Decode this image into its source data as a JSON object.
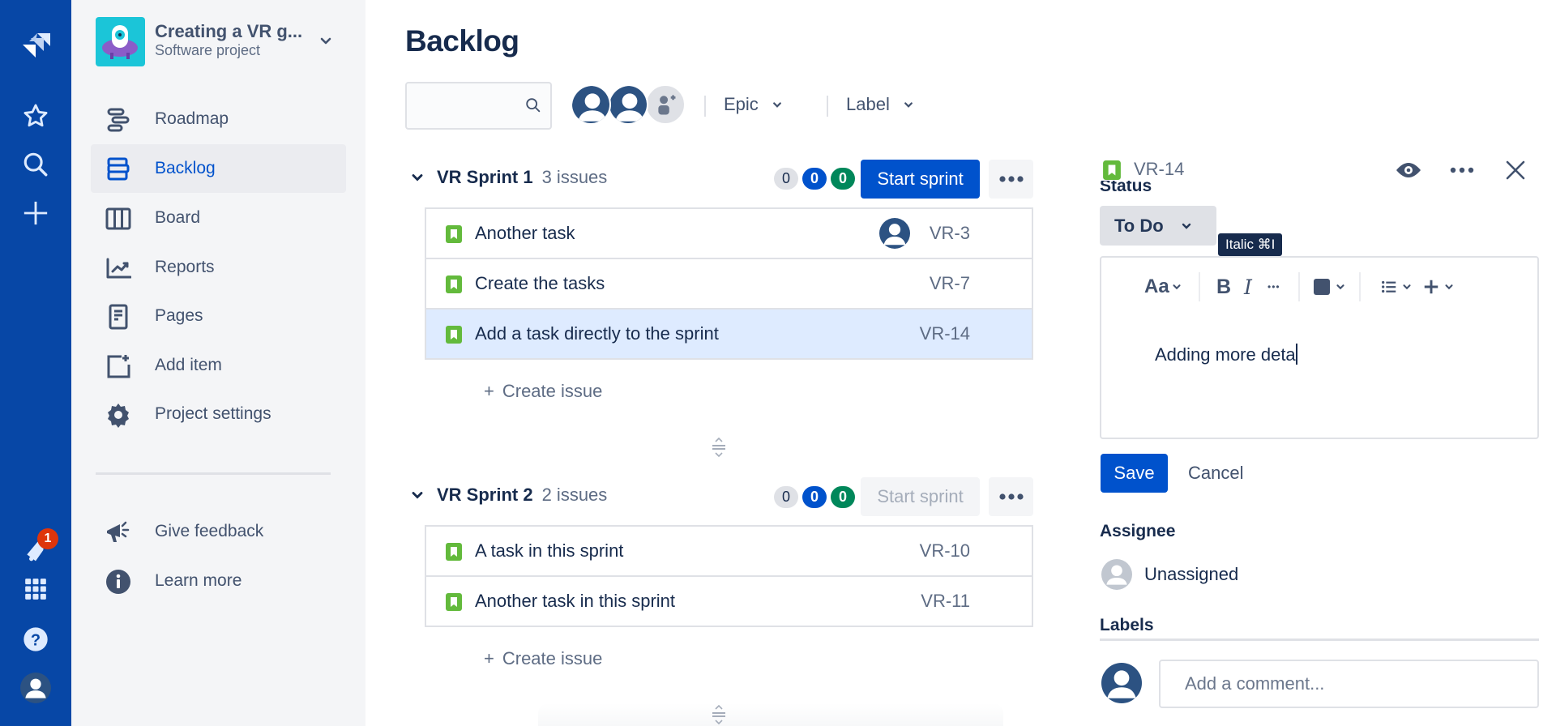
{
  "global_nav": {
    "notification_count": "1",
    "icons": [
      "jira-logo-icon",
      "star-icon",
      "search-icon",
      "plus-icon",
      "bell-icon",
      "app-switcher-icon",
      "help-icon",
      "profile-avatar-icon"
    ]
  },
  "project": {
    "name": "Creating a VR g...",
    "type": "Software project"
  },
  "sidebar": {
    "items": [
      {
        "label": "Roadmap",
        "icon": "roadmap-icon"
      },
      {
        "label": "Backlog",
        "icon": "backlog-icon",
        "active": true
      },
      {
        "label": "Board",
        "icon": "board-icon"
      },
      {
        "label": "Reports",
        "icon": "reports-icon"
      },
      {
        "label": "Pages",
        "icon": "pages-icon"
      },
      {
        "label": "Add item",
        "icon": "add-item-icon"
      },
      {
        "label": "Project settings",
        "icon": "gear-icon"
      }
    ],
    "footer": [
      {
        "label": "Give feedback",
        "icon": "megaphone-icon"
      },
      {
        "label": "Learn more",
        "icon": "info-icon"
      }
    ]
  },
  "page": {
    "title": "Backlog",
    "search_placeholder": "",
    "filters": {
      "epic": "Epic",
      "label": "Label"
    }
  },
  "sprints": [
    {
      "name": "VR Sprint 1",
      "count": "3 issues",
      "lozenges": [
        "0",
        "0",
        "0"
      ],
      "start_label": "Start sprint",
      "start_enabled": true,
      "issues": [
        {
          "summary": "Another task",
          "key": "VR-3",
          "has_assignee": true
        },
        {
          "summary": "Create the tasks",
          "key": "VR-7"
        },
        {
          "summary": "Add a task directly to the sprint",
          "key": "VR-14",
          "selected": true
        }
      ],
      "create_label": "Create issue"
    },
    {
      "name": "VR Sprint 2",
      "count": "2 issues",
      "lozenges": [
        "0",
        "0",
        "0"
      ],
      "start_label": "Start sprint",
      "start_enabled": false,
      "issues": [
        {
          "summary": "A task in this sprint",
          "key": "VR-10"
        },
        {
          "summary": "Another task in this sprint",
          "key": "VR-11"
        }
      ],
      "create_label": "Create issue"
    }
  ],
  "detail": {
    "key": "VR-14",
    "status_label": "Status",
    "status_value": "To Do",
    "tooltip": "Italic ⌘I",
    "toolbar": {
      "text_style": "Aa",
      "bold": "B",
      "italic": "I",
      "more": "•••"
    },
    "description_text": "Adding more deta",
    "save_label": "Save",
    "cancel_label": "Cancel",
    "assignee_label": "Assignee",
    "assignee_value": "Unassigned",
    "labels_label": "Labels",
    "comment_placeholder": "Add a comment..."
  },
  "colors": {
    "nav_bg": "#0747A6",
    "primary": "#0052CC",
    "story_green": "#63BA3C",
    "selected_row": "#DEEBFF",
    "done_green": "#00875A"
  }
}
